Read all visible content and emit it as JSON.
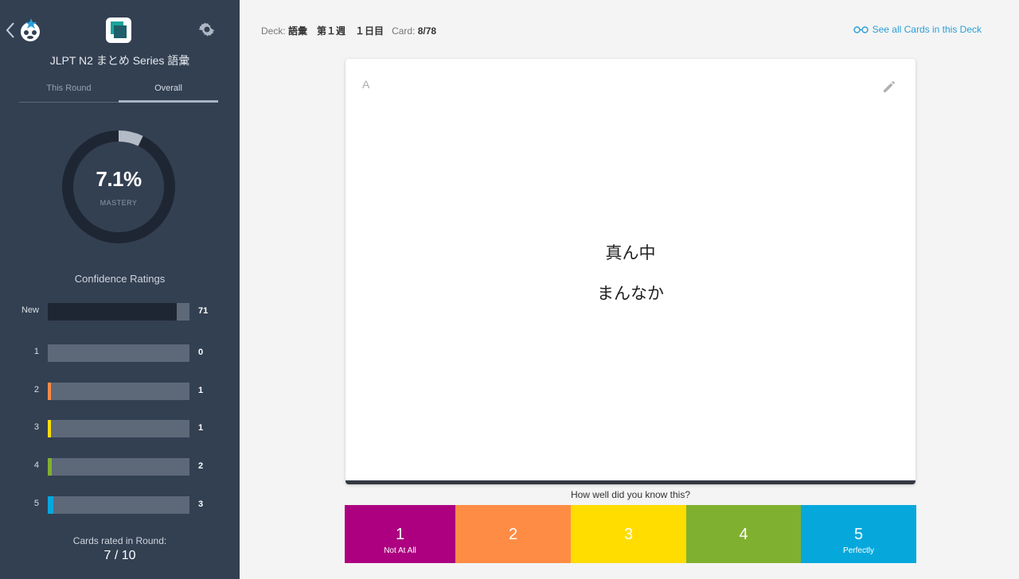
{
  "sidebar": {
    "deck_title": "JLPT N2 まとめ Series 語彙",
    "tabs": [
      "This Round",
      "Overall"
    ],
    "active_tab": "Overall",
    "mastery": {
      "value": "7.1%",
      "label": "MASTERY",
      "fraction": 0.071
    },
    "confidence_title": "Confidence Ratings",
    "ratings": [
      {
        "label": "New",
        "count": "71",
        "fill_fraction": 0.91,
        "color": "#1f2633"
      },
      {
        "label": "1",
        "count": "0",
        "fill_fraction": 0.0,
        "color": "#ac007f"
      },
      {
        "label": "2",
        "count": "1",
        "fill_fraction": 0.013,
        "color": "#ff8a45"
      },
      {
        "label": "3",
        "count": "1",
        "fill_fraction": 0.013,
        "color": "#ffdd00"
      },
      {
        "label": "4",
        "count": "2",
        "fill_fraction": 0.026,
        "color": "#80b030"
      },
      {
        "label": "5",
        "count": "3",
        "fill_fraction": 0.038,
        "color": "#06a7de"
      }
    ],
    "round_label": "Cards rated in Round:",
    "round_value": "7 / 10"
  },
  "topbar": {
    "deck_label": "Deck:",
    "deck_value": "語彙　第１週　１日目",
    "card_label": "Card:",
    "card_value": "8/78",
    "see_all": "See all Cards in this Deck"
  },
  "card": {
    "side": "A",
    "front": "真ん中",
    "reading": "まんなか"
  },
  "question": "How well did you know this?",
  "rating_buttons": [
    {
      "num": "1",
      "sub": "Not At All",
      "color": "#ac0080"
    },
    {
      "num": "2",
      "sub": "",
      "color": "#ff8c45"
    },
    {
      "num": "3",
      "sub": "",
      "color": "#ffdd00"
    },
    {
      "num": "4",
      "sub": "",
      "color": "#80b030"
    },
    {
      "num": "5",
      "sub": "Perfectly",
      "color": "#06a8dc"
    }
  ],
  "icons": {
    "back": "chevron-left-icon",
    "logo": "brainscape-logo",
    "deck": "deck-cards-icon",
    "settings": "gear-icon",
    "see_all": "glasses-icon",
    "edit": "pencil-icon"
  }
}
